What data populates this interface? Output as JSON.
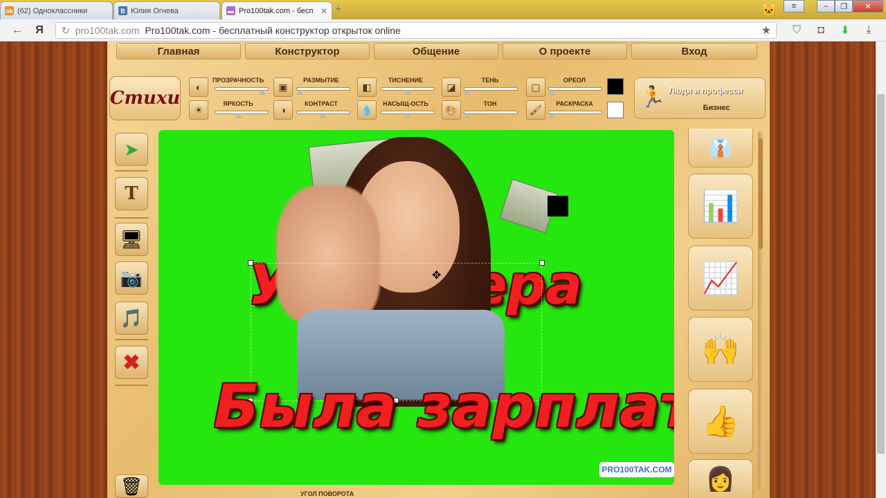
{
  "browser": {
    "tabs": [
      {
        "label": "(62) Одноклассники",
        "icon": "odnoklassniki-icon",
        "color": "#f08c1c"
      },
      {
        "label": "Юлия Огнева",
        "icon": "vk-icon",
        "color": "#4a76a8"
      },
      {
        "label": "Pro100tak.com - бесп",
        "icon": "site-icon",
        "color": "#b06ad0",
        "active": true
      }
    ],
    "url_domain": "pro100tak.com",
    "url_title": "Pro100tak.com - бесплатный конструктор открыток online",
    "ya": "Я"
  },
  "nav": {
    "items": [
      "Главная",
      "Конструктор",
      "Общение",
      "О проекте",
      "Вход"
    ]
  },
  "controls": {
    "logo": "Стихи",
    "row1": [
      "ПРОЗРАЧНОСТЬ",
      "РАЗМЫТИЕ",
      "ТИСНЕНИЕ",
      "ТЕНЬ",
      "ОРЕОЛ"
    ],
    "row2": [
      "ЯРКОСТЬ",
      "КОНТРАСТ",
      "НАСЫЩ-ОСТЬ",
      "ТОН",
      "РАСКРАСКА"
    ],
    "color1": "#000000",
    "color2": "#ffffff"
  },
  "category": {
    "title": "Люди и професси",
    "subtitle": "Бизнес"
  },
  "canvas": {
    "line1": "Уже вчера",
    "line2": "Была зарплата!",
    "watermark": "PRO100TAK.COM",
    "background": "#26e60f"
  },
  "bottom": {
    "rotate_label": "УГОЛ ПОВОРОТА"
  }
}
